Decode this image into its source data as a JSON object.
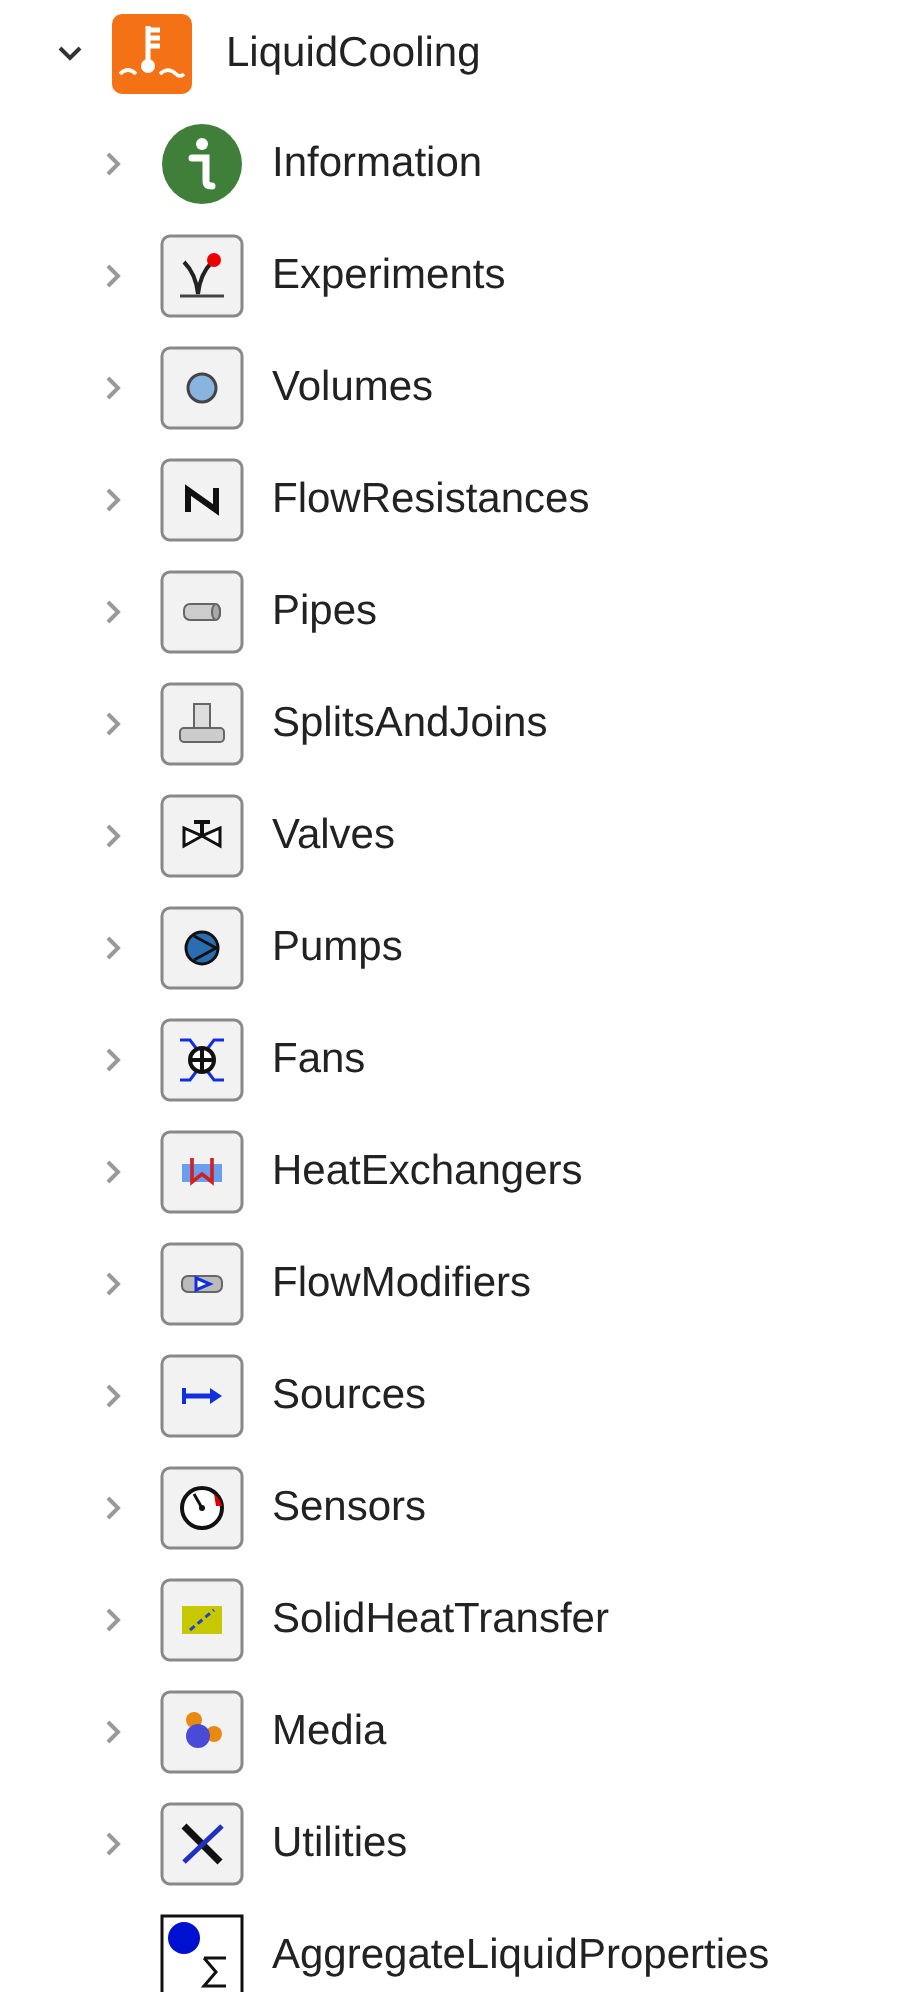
{
  "tree": {
    "label": "LiquidCooling",
    "expanded": true,
    "children": [
      {
        "label": "Information",
        "expandable": true
      },
      {
        "label": "Experiments",
        "expandable": true
      },
      {
        "label": "Volumes",
        "expandable": true
      },
      {
        "label": "FlowResistances",
        "expandable": true
      },
      {
        "label": "Pipes",
        "expandable": true
      },
      {
        "label": "SplitsAndJoins",
        "expandable": true
      },
      {
        "label": "Valves",
        "expandable": true
      },
      {
        "label": "Pumps",
        "expandable": true
      },
      {
        "label": "Fans",
        "expandable": true
      },
      {
        "label": "HeatExchangers",
        "expandable": true
      },
      {
        "label": "FlowModifiers",
        "expandable": true
      },
      {
        "label": "Sources",
        "expandable": true
      },
      {
        "label": "Sensors",
        "expandable": true
      },
      {
        "label": "SolidHeatTransfer",
        "expandable": true
      },
      {
        "label": "Media",
        "expandable": true
      },
      {
        "label": "Utilities",
        "expandable": true
      },
      {
        "label": "AggregateLiquidProperties",
        "expandable": false
      }
    ]
  }
}
